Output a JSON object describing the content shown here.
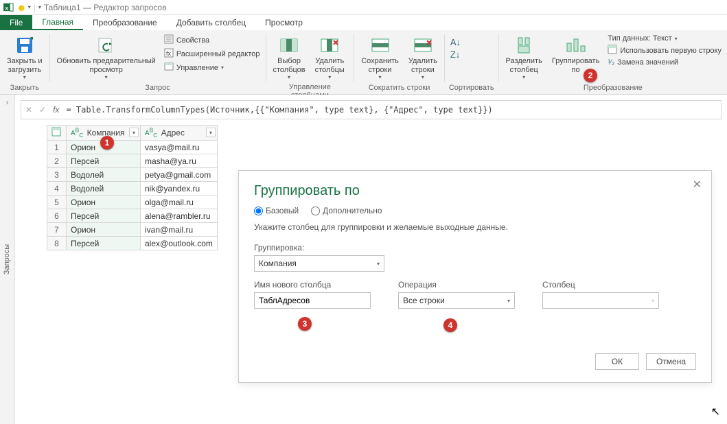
{
  "titlebar": {
    "title": "Таблица1 — Редактор запросов"
  },
  "tabs": {
    "file": "File",
    "home": "Главная",
    "transform": "Преобразование",
    "addcol": "Добавить столбец",
    "view": "Просмотр"
  },
  "ribbon": {
    "close": {
      "big": "Закрыть и\nзагрузить",
      "group": "Закрыть"
    },
    "query": {
      "refresh": "Обновить предварительный\nпросмотр",
      "props": "Свойства",
      "adv": "Расширенный редактор",
      "manage": "Управление",
      "group": "Запрос"
    },
    "cols": {
      "select": "Выбор\nстолбцов",
      "remove": "Удалить\nстолбцы",
      "group": "Управление столбцами"
    },
    "rows": {
      "keep": "Сохранить\nстроки",
      "remove": "Удалить\nстроки",
      "group": "Сократить строки"
    },
    "sort": {
      "group": "Сортировать"
    },
    "transform": {
      "split": "Разделить\nстолбец",
      "groupby": "Группировать\nпо",
      "datatype": "Тип данных: Текст",
      "header": "Использовать первую строку",
      "replace": "Замена значений",
      "group": "Преобразование"
    }
  },
  "fbar": {
    "formula": "= Table.TransformColumnTypes(Источник,{{\"Компания\", type text}, {\"Адрес\", type text}})"
  },
  "queries_panel": "Запросы",
  "table": {
    "columns": [
      "Компания",
      "Адрес"
    ],
    "rows": [
      [
        "Орион",
        "vasya@mail.ru"
      ],
      [
        "Персей",
        "masha@ya.ru"
      ],
      [
        "Водолей",
        "petya@gmail.com"
      ],
      [
        "Водолей",
        "nik@yandex.ru"
      ],
      [
        "Орион",
        "olga@mail.ru"
      ],
      [
        "Персей",
        "alena@rambler.ru"
      ],
      [
        "Орион",
        "ivan@mail.ru"
      ],
      [
        "Персей",
        "alex@outlook.com"
      ]
    ]
  },
  "dialog": {
    "title": "Группировать по",
    "basic": "Базовый",
    "advanced": "Дополнительно",
    "hint": "Укажите столбец для группировки и желаемые выходные данные.",
    "groupby_label": "Группировка:",
    "groupby_value": "Компания",
    "newcol_label": "Имя нового столбца",
    "newcol_value": "ТаблАдресов",
    "op_label": "Операция",
    "op_value": "Все строки",
    "col_label": "Столбец",
    "col_value": "",
    "ok": "ОК",
    "cancel": "Отмена"
  },
  "badges": {
    "b1": "1",
    "b2": "2",
    "b3": "3",
    "b4": "4"
  }
}
